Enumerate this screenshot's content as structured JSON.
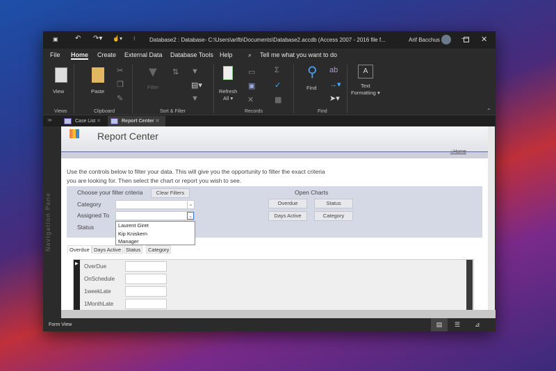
{
  "window": {
    "title": "Database2 : Database- C:\\Users\\arifb\\Documents\\Database2.accdb (Access 2007 - 2016 file f...",
    "user": "Arif Bacchus"
  },
  "menu": {
    "items": [
      "File",
      "Home",
      "Create",
      "External Data",
      "Database Tools",
      "Help"
    ],
    "active": "Home",
    "tell_me": "Tell me what you want to do"
  },
  "ribbon": {
    "view": "View",
    "paste": "Paste",
    "filter": "Filter",
    "refresh": "Refresh",
    "refresh_all": "All",
    "find": "Find",
    "text": "Text",
    "formatting": "Formatting",
    "groups": [
      "Views",
      "Clipboard",
      "Sort & Filter",
      "Records",
      "Find"
    ],
    "text_icon": "A"
  },
  "doc_tabs": [
    {
      "label": "Case List",
      "active": false
    },
    {
      "label": "Report Center",
      "active": true
    }
  ],
  "nav_pane": "Navigation Pane",
  "form": {
    "title": "Report Center",
    "home_link": "Home",
    "intro_line1": "Use the controls below to filter your data. This will give you the opportunity to filter the exact criteria",
    "intro_line2": "you are looking for. Then select the chart or report you wish to see.",
    "filter_heading": "Choose your filter criteria",
    "clear_filters": "Clear Filters",
    "labels": {
      "category": "Category",
      "assigned_to": "Assigned To",
      "status": "Status"
    },
    "dropdown_options": [
      "Laurent Giret",
      "Kip Kniskern",
      "Manager"
    ],
    "open_charts": "Open Charts",
    "chart_buttons": [
      "Overdue",
      "Status",
      "Days Active",
      "Category"
    ],
    "tabs": [
      "Overdue",
      "Days Active",
      "Status",
      "Category"
    ],
    "active_tab": "Overdue",
    "fields": [
      "OverDue",
      "OnSchedule",
      "1weekLate",
      "1MonthLate"
    ]
  },
  "status_bar": {
    "label": "Form View"
  }
}
